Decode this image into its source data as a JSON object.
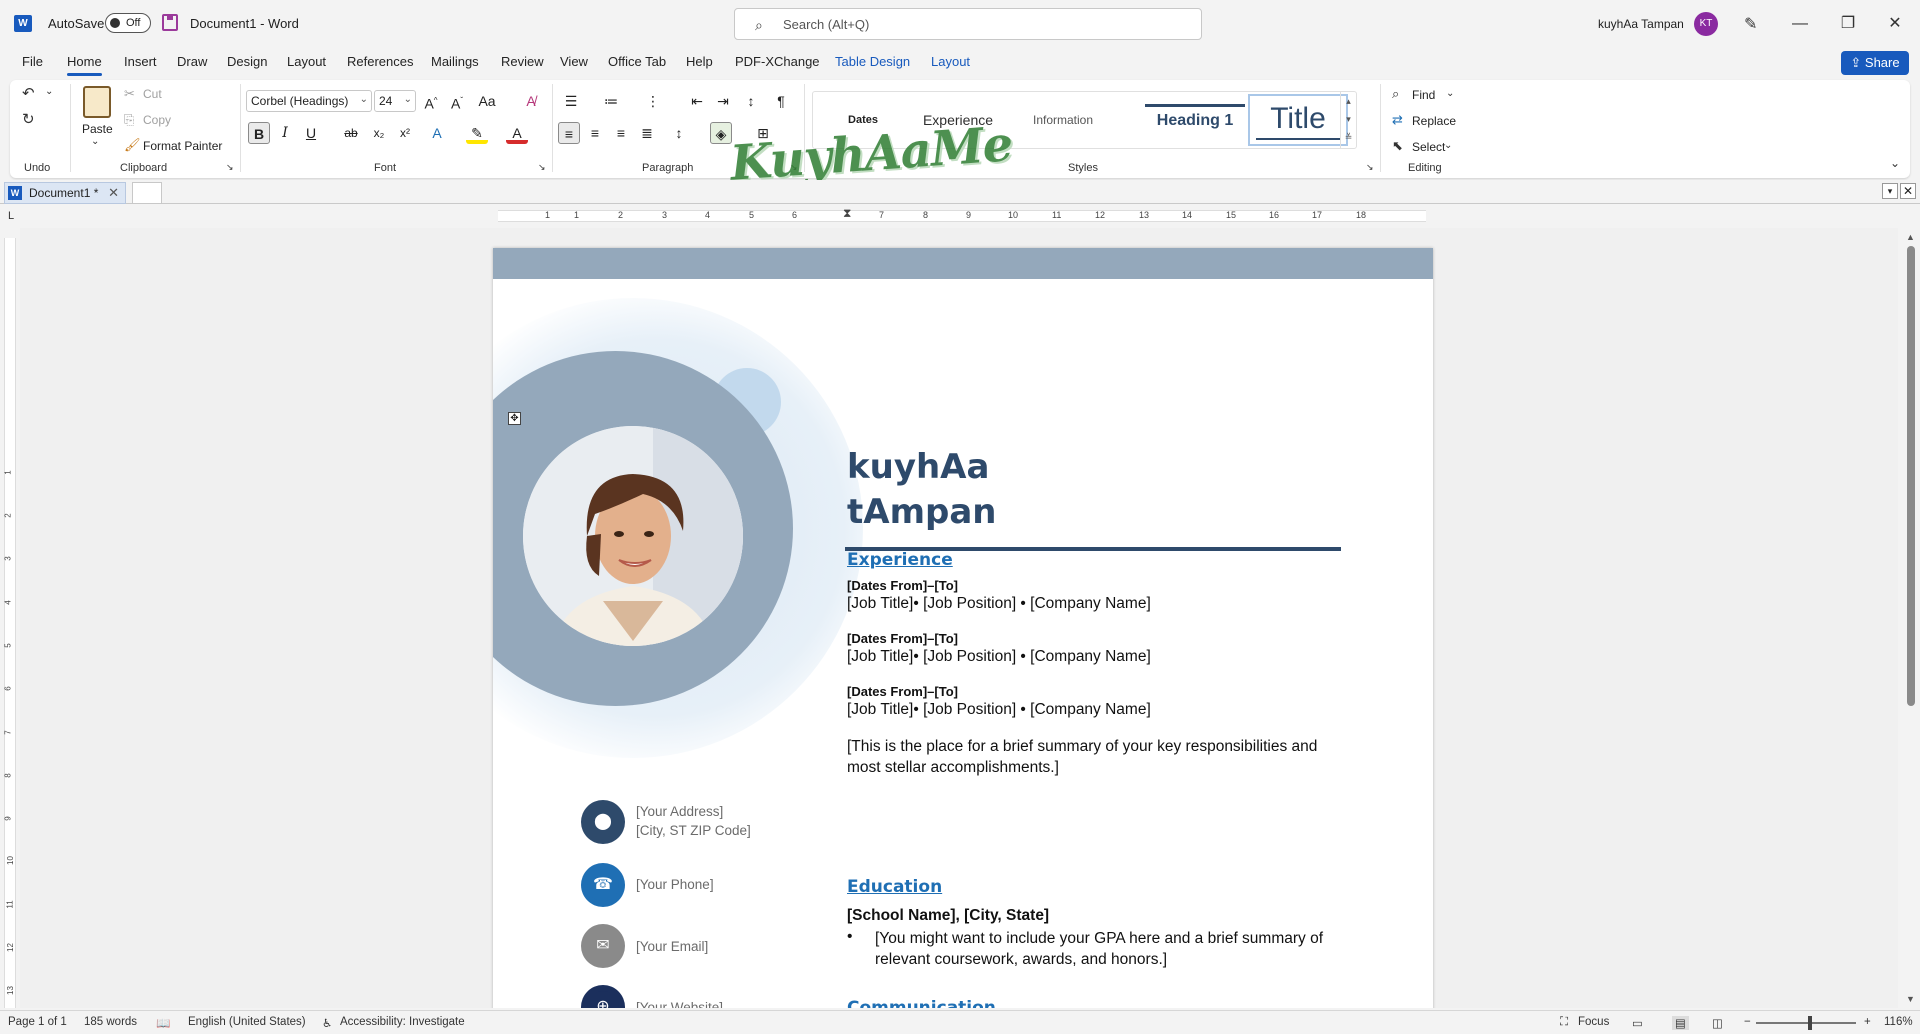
{
  "titlebar": {
    "app_icon": "W",
    "autosave_label": "AutoSave",
    "autosave_state": "Off",
    "doc_title": "Document1  -  Word",
    "search_placeholder": "Search (Alt+Q)",
    "user_name": "kuyhAa Tampan",
    "user_initials": "KT",
    "minimize": "—",
    "restore": "❐",
    "close": "✕"
  },
  "menu": {
    "items": [
      "File",
      "Home",
      "Insert",
      "Draw",
      "Design",
      "Layout",
      "References",
      "Mailings",
      "Review",
      "View",
      "Office Tab",
      "Help",
      "PDF-XChange",
      "Table Design",
      "Layout"
    ],
    "share": "Share"
  },
  "ribbon": {
    "undo_group": "Undo",
    "clipboard": {
      "paste": "Paste",
      "cut": "Cut",
      "copy": "Copy",
      "format_painter": "Format Painter",
      "group": "Clipboard"
    },
    "font": {
      "name": "Corbel (Headings)",
      "size": "24",
      "group": "Font"
    },
    "paragraph_group": "Paragraph",
    "styles": {
      "items": [
        "Dates",
        "Experience",
        "Information",
        "Heading 1",
        "Title"
      ],
      "group": "Styles"
    },
    "editing": {
      "find": "Find",
      "replace": "Replace",
      "select": "Select",
      "group": "Editing"
    },
    "watermark": "KuyhAaMe"
  },
  "tabs": {
    "doc_tab": "Document1 *"
  },
  "ruler": {
    "h_numbers": [
      "1",
      "1",
      "2",
      "3",
      "4",
      "5",
      "6",
      "7",
      "8",
      "9",
      "10",
      "11",
      "12",
      "13",
      "14",
      "15",
      "16",
      "17",
      "18"
    ],
    "v_numbers": [
      "1",
      "2",
      "3",
      "4",
      "5",
      "6",
      "7",
      "8",
      "9",
      "10",
      "11",
      "12",
      "13"
    ]
  },
  "document": {
    "name_line1": "kuyhAa",
    "name_line2": "tAmpan",
    "experience_heading": "Experience",
    "jobs": [
      {
        "dates": "[Dates From]–[To]",
        "line": "[Job Title]• [Job Position] • [Company Name]"
      },
      {
        "dates": "[Dates From]–[To]",
        "line": "[Job Title]• [Job Position] • [Company Name]"
      },
      {
        "dates": "[Dates From]–[To]",
        "line": "[Job Title]• [Job Position] • [Company Name]"
      }
    ],
    "summary": "[This is the place for a brief summary of your key responsibilities and most stellar accomplishments.]",
    "education_heading": "Education",
    "school": "[School Name], [City, State]",
    "edu_bullet": "•",
    "edu_note": "[You might want to include your GPA here and a brief summary of relevant coursework, awards, and honors.]",
    "next_heading_partial": "Communication",
    "contact": {
      "address1": "[Your Address]",
      "address2": "[City, ST ZIP Code]",
      "phone": "[Your Phone]",
      "email": "[Your Email]",
      "website": "[Your Website]"
    }
  },
  "status": {
    "page": "Page 1 of 1",
    "words": "185 words",
    "language": "English (United States)",
    "accessibility": "Accessibility: Investigate",
    "focus": "Focus",
    "zoom": "116%"
  },
  "colors": {
    "accent": "#185abd",
    "name_color": "#2e4a6b",
    "heading_color": "#1f6fb4",
    "band": "#94a8bb"
  }
}
